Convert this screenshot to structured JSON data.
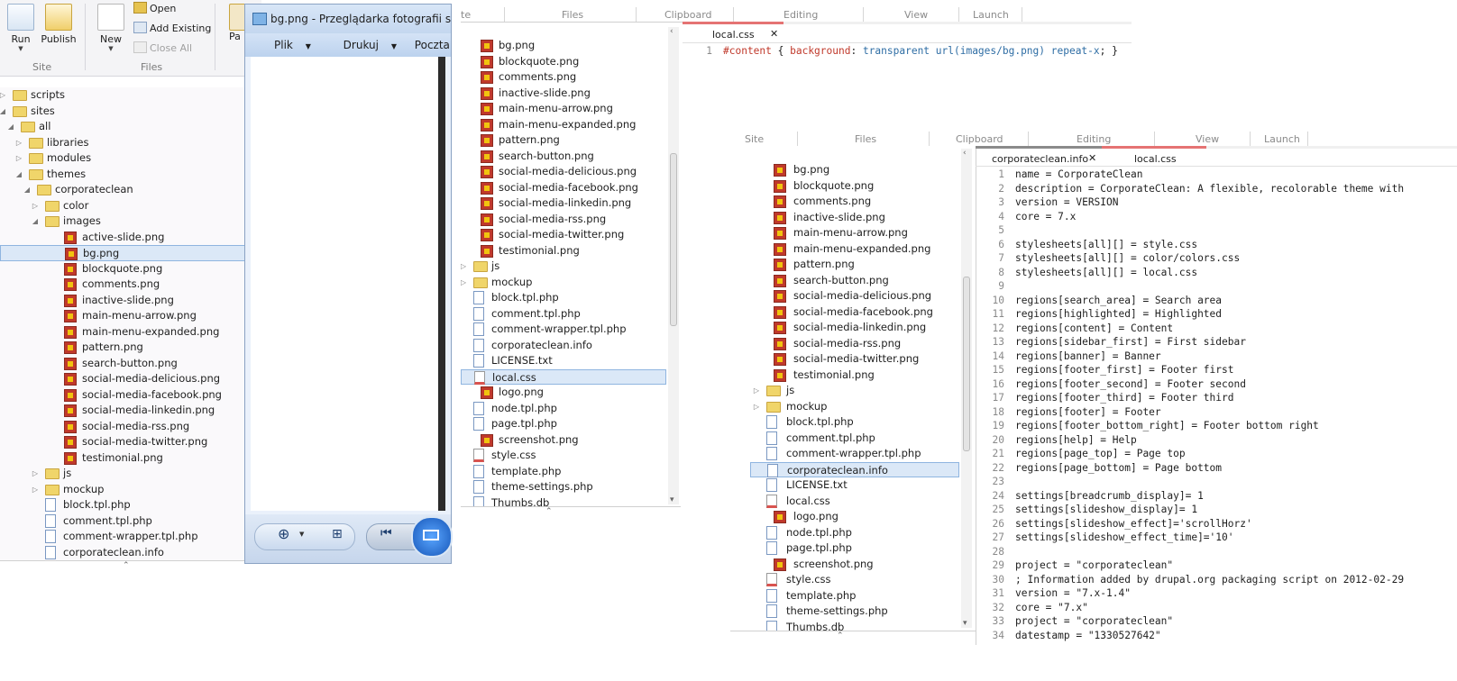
{
  "ribbon": {
    "run": "Run",
    "publish": "Publish",
    "new": "New",
    "open": "Open",
    "add_existing": "Add Existing",
    "close_all": "Close All",
    "paste_partial": "Pa",
    "group_site": "Site",
    "group_files": "Files"
  },
  "tree1": [
    {
      "label": "scripts",
      "type": "folder",
      "indent": 1,
      "tw": "▷"
    },
    {
      "label": "sites",
      "type": "folder",
      "indent": 1,
      "tw": "◢"
    },
    {
      "label": "all",
      "type": "folder",
      "indent": 2,
      "tw": "◢"
    },
    {
      "label": "libraries",
      "type": "folder",
      "indent": 3,
      "tw": "▷"
    },
    {
      "label": "modules",
      "type": "folder",
      "indent": 3,
      "tw": "▷"
    },
    {
      "label": "themes",
      "type": "folder",
      "indent": 3,
      "tw": "◢"
    },
    {
      "label": "corporateclean",
      "type": "folder",
      "indent": 4,
      "tw": "◢"
    },
    {
      "label": "color",
      "type": "folder",
      "indent": 5,
      "tw": "▷"
    },
    {
      "label": "images",
      "type": "folder",
      "indent": 5,
      "tw": "◢"
    },
    {
      "label": "active-slide.png",
      "type": "img",
      "indent": 6
    },
    {
      "label": "bg.png",
      "type": "img",
      "indent": 6,
      "selected": true
    },
    {
      "label": "blockquote.png",
      "type": "img",
      "indent": 6
    },
    {
      "label": "comments.png",
      "type": "img",
      "indent": 6
    },
    {
      "label": "inactive-slide.png",
      "type": "img",
      "indent": 6
    },
    {
      "label": "main-menu-arrow.png",
      "type": "img",
      "indent": 6
    },
    {
      "label": "main-menu-expanded.png",
      "type": "img",
      "indent": 6
    },
    {
      "label": "pattern.png",
      "type": "img",
      "indent": 6
    },
    {
      "label": "search-button.png",
      "type": "img",
      "indent": 6
    },
    {
      "label": "social-media-delicious.png",
      "type": "img",
      "indent": 6
    },
    {
      "label": "social-media-facebook.png",
      "type": "img",
      "indent": 6
    },
    {
      "label": "social-media-linkedin.png",
      "type": "img",
      "indent": 6
    },
    {
      "label": "social-media-rss.png",
      "type": "img",
      "indent": 6
    },
    {
      "label": "social-media-twitter.png",
      "type": "img",
      "indent": 6
    },
    {
      "label": "testimonial.png",
      "type": "img",
      "indent": 6
    },
    {
      "label": "js",
      "type": "folder",
      "indent": 5,
      "tw": "▷"
    },
    {
      "label": "mockup",
      "type": "folder",
      "indent": 5,
      "tw": "▷"
    },
    {
      "label": "block.tpl.php",
      "type": "doc",
      "indent": 5
    },
    {
      "label": "comment.tpl.php",
      "type": "doc",
      "indent": 5
    },
    {
      "label": "comment-wrapper.tpl.php",
      "type": "doc",
      "indent": 5
    },
    {
      "label": "corporateclean.info",
      "type": "doc",
      "indent": 5
    }
  ],
  "viewer": {
    "title": "bg.png - Przeglądarka fotografii systemu",
    "menu_file": "Plik",
    "menu_print": "Drukuj",
    "menu_email": "Poczta e-mail"
  },
  "editor1": {
    "ribbon": [
      "te",
      "Files",
      "Clipboard",
      "Editing",
      "View",
      "Launch"
    ],
    "tab": "local.css",
    "line_no": "1",
    "code_selector": "#content",
    "code_brace_open": " { ",
    "code_prop": "background",
    "code_colon": ": ",
    "code_val": "transparent url(images/bg.png) repeat-x",
    "code_end": "; }"
  },
  "tree2": [
    {
      "label": "bg.png",
      "type": "img"
    },
    {
      "label": "blockquote.png",
      "type": "img"
    },
    {
      "label": "comments.png",
      "type": "img"
    },
    {
      "label": "inactive-slide.png",
      "type": "img"
    },
    {
      "label": "main-menu-arrow.png",
      "type": "img"
    },
    {
      "label": "main-menu-expanded.png",
      "type": "img"
    },
    {
      "label": "pattern.png",
      "type": "img"
    },
    {
      "label": "search-button.png",
      "type": "img"
    },
    {
      "label": "social-media-delicious.png",
      "type": "img"
    },
    {
      "label": "social-media-facebook.png",
      "type": "img"
    },
    {
      "label": "social-media-linkedin.png",
      "type": "img"
    },
    {
      "label": "social-media-rss.png",
      "type": "img"
    },
    {
      "label": "social-media-twitter.png",
      "type": "img"
    },
    {
      "label": "testimonial.png",
      "type": "img"
    },
    {
      "label": "js",
      "type": "folder",
      "tw": "▷"
    },
    {
      "label": "mockup",
      "type": "folder",
      "tw": "▷"
    },
    {
      "label": "block.tpl.php",
      "type": "doc"
    },
    {
      "label": "comment.tpl.php",
      "type": "doc"
    },
    {
      "label": "comment-wrapper.tpl.php",
      "type": "doc"
    },
    {
      "label": "corporateclean.info",
      "type": "doc"
    },
    {
      "label": "LICENSE.txt",
      "type": "doc"
    },
    {
      "label": "local.css",
      "type": "css"
    },
    {
      "label": "logo.png",
      "type": "img"
    },
    {
      "label": "node.tpl.php",
      "type": "doc"
    },
    {
      "label": "page.tpl.php",
      "type": "doc"
    },
    {
      "label": "screenshot.png",
      "type": "img"
    },
    {
      "label": "style.css",
      "type": "css"
    },
    {
      "label": "template.php",
      "type": "doc"
    },
    {
      "label": "theme-settings.php",
      "type": "doc"
    },
    {
      "label": "Thumbs.db",
      "type": "doc"
    }
  ],
  "editor2": {
    "ribbon": [
      "Site",
      "Files",
      "Clipboard",
      "Editing",
      "View",
      "Launch"
    ],
    "tab_active": "corporateclean.info",
    "tab_other": "local.css",
    "lines": [
      "name = CorporateClean",
      "description = CorporateClean: A flexible, recolorable theme with",
      "version = VERSION",
      "core = 7.x",
      "",
      "stylesheets[all][] = style.css",
      "stylesheets[all][] = color/colors.css",
      "stylesheets[all][] = local.css",
      "",
      "regions[search_area] = Search area",
      "regions[highlighted] = Highlighted",
      "regions[content] = Content",
      "regions[sidebar_first] = First sidebar",
      "regions[banner] = Banner",
      "regions[footer_first] = Footer first",
      "regions[footer_second] = Footer second",
      "regions[footer_third] = Footer third",
      "regions[footer] = Footer",
      "regions[footer_bottom_right] = Footer bottom right",
      "regions[help] = Help",
      "regions[page_top] = Page top",
      "regions[page_bottom] = Page bottom",
      "",
      "settings[breadcrumb_display]= 1",
      "settings[slideshow_display]= 1",
      "settings[slideshow_effect]='scrollHorz'",
      "settings[slideshow_effect_time]='10'",
      "",
      "project = \"corporateclean\"",
      "; Information added by drupal.org packaging script on 2012-02-29",
      "version = \"7.x-1.4\"",
      "core = \"7.x\"",
      "project = \"corporateclean\"",
      "datestamp = \"1330527642\""
    ]
  },
  "colors": {
    "selection": "#dbe8f7",
    "tab_accent": "#e57373",
    "code_keyword": "#c0392b",
    "code_value": "#2e6da4"
  }
}
